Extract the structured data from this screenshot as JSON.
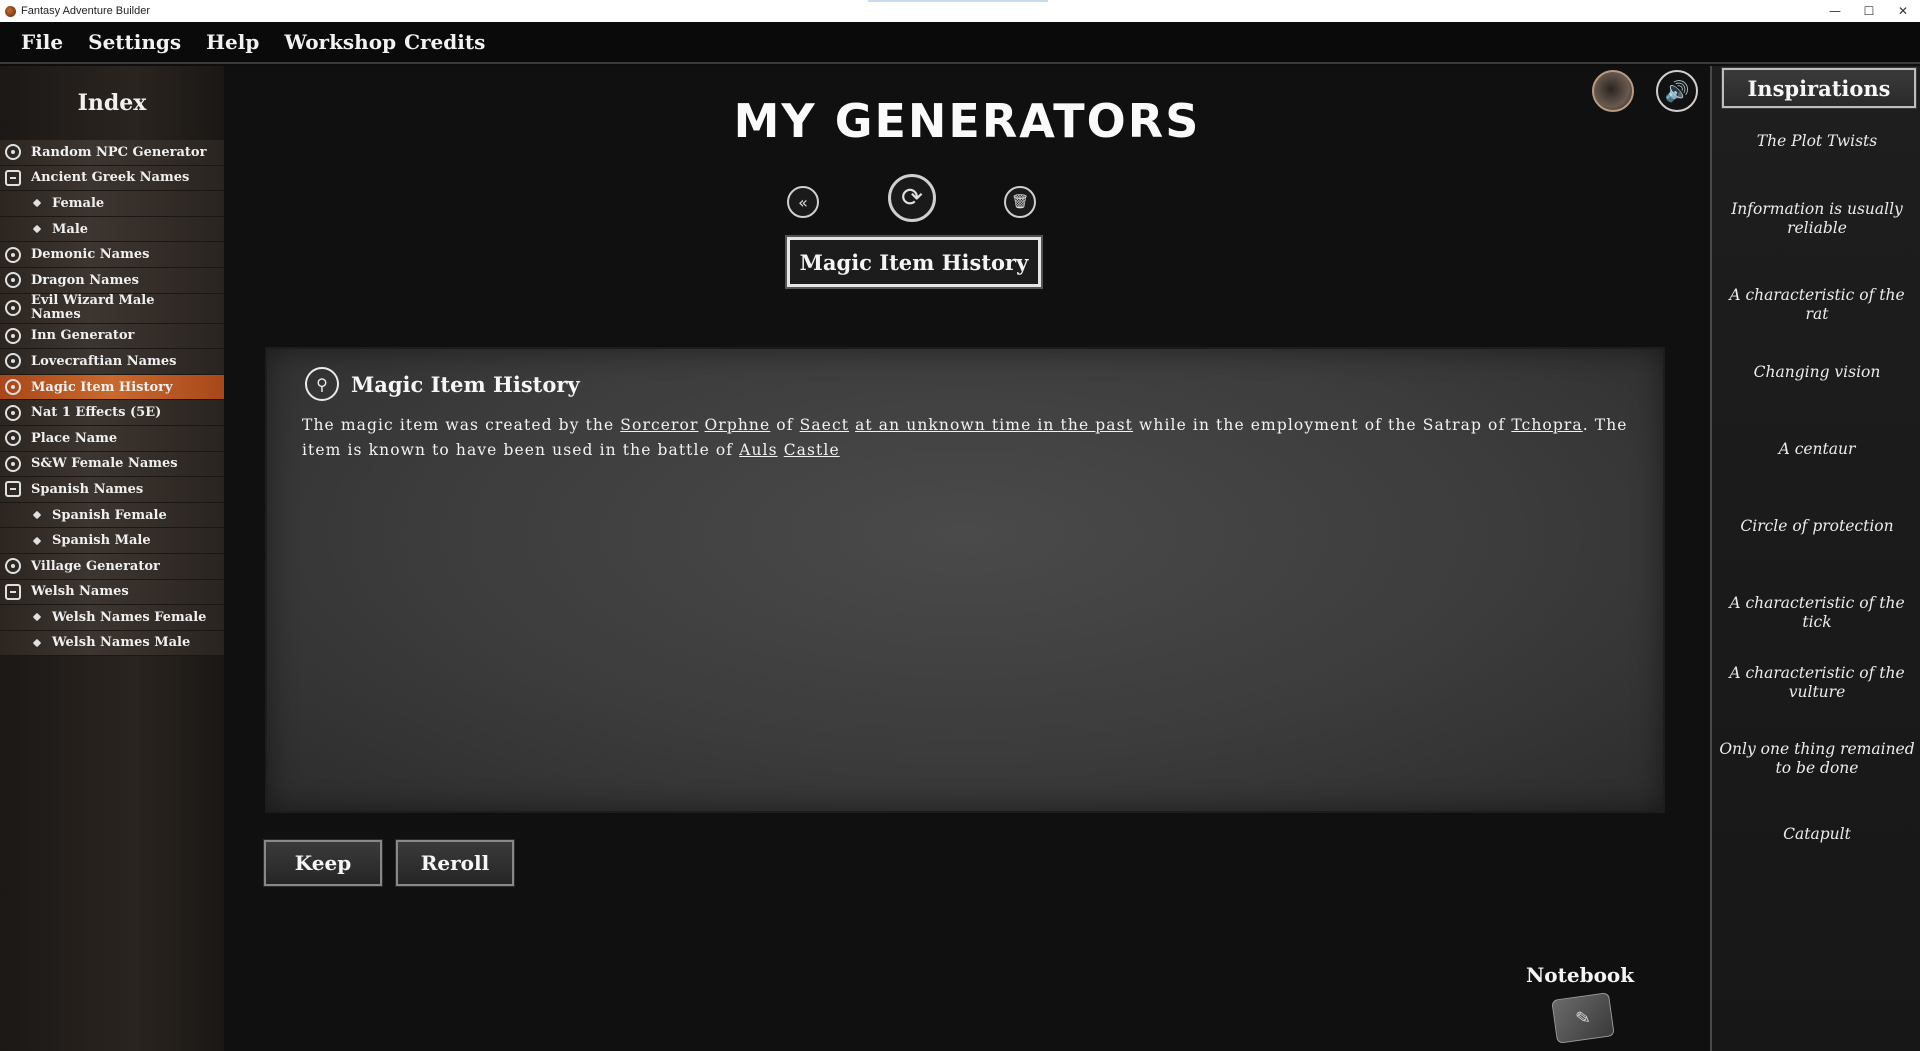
{
  "window": {
    "title": "Fantasy Adventure Builder",
    "controls": {
      "minimize": "—",
      "maximize": "☐",
      "close": "✕"
    }
  },
  "menu": {
    "file": "File",
    "settings": "Settings",
    "help": "Help",
    "workshop": "Workshop",
    "credits": "Credits"
  },
  "sidebar": {
    "title": "Index",
    "items": [
      {
        "label": "Random NPC Generator",
        "kind": "generator",
        "icon": "target-icon"
      },
      {
        "label": "Ancient Greek Names",
        "kind": "folder",
        "icon": "folder-icon"
      },
      {
        "label": "Female",
        "kind": "sub",
        "icon": "diamond-icon"
      },
      {
        "label": "Male",
        "kind": "sub",
        "icon": "diamond-icon"
      },
      {
        "label": "Demonic Names",
        "kind": "generator",
        "icon": "target-icon"
      },
      {
        "label": "Dragon Names",
        "kind": "generator",
        "icon": "target-icon"
      },
      {
        "label": "Evil Wizard Male Names",
        "kind": "generator",
        "icon": "target-icon"
      },
      {
        "label": "Inn Generator",
        "kind": "generator",
        "icon": "target-icon"
      },
      {
        "label": "Lovecraftian Names",
        "kind": "generator",
        "icon": "target-icon"
      },
      {
        "label": "Magic Item History",
        "kind": "generator",
        "icon": "target-icon",
        "active": true
      },
      {
        "label": "Nat 1 Effects (5E)",
        "kind": "generator",
        "icon": "target-icon"
      },
      {
        "label": "Place Name",
        "kind": "generator",
        "icon": "target-icon"
      },
      {
        "label": "S&W Female Names",
        "kind": "generator",
        "icon": "target-icon"
      },
      {
        "label": "Spanish Names",
        "kind": "folder",
        "icon": "folder-icon"
      },
      {
        "label": "Spanish Female",
        "kind": "sub",
        "icon": "diamond-icon"
      },
      {
        "label": "Spanish Male",
        "kind": "sub",
        "icon": "diamond-icon"
      },
      {
        "label": "Village Generator",
        "kind": "generator",
        "icon": "target-icon"
      },
      {
        "label": "Welsh Names",
        "kind": "folder",
        "icon": "folder-icon"
      },
      {
        "label": "Welsh Names Female",
        "kind": "sub",
        "icon": "diamond-icon"
      },
      {
        "label": "Welsh Names Male",
        "kind": "sub",
        "icon": "diamond-icon"
      }
    ]
  },
  "main": {
    "page_title": "MY GENERATORS",
    "toolbar": {
      "back_icon": "«",
      "reroll_icon": "⟳",
      "trash_icon": "🗑"
    },
    "selected_generator": "Magic Item History",
    "result": {
      "header": "Magic Item History",
      "header_icon": "pin-icon",
      "segments": [
        {
          "text": "The magic item was created by the ",
          "link": false
        },
        {
          "text": "Sorceror",
          "link": true
        },
        {
          "text": " ",
          "link": false
        },
        {
          "text": "Orphne",
          "link": true
        },
        {
          "text": " of ",
          "link": false
        },
        {
          "text": "Saect",
          "link": true
        },
        {
          "text": " ",
          "link": false
        },
        {
          "text": "at an unknown time in the past",
          "link": true
        },
        {
          "text": " while in the employment of the Satrap of ",
          "link": false
        },
        {
          "text": "Tchopra",
          "link": true
        },
        {
          "text": ". The item is known to have been used in the battle of ",
          "link": false
        },
        {
          "text": "Auls",
          "link": true
        },
        {
          "text": " ",
          "link": false
        },
        {
          "text": "Castle",
          "link": true
        }
      ]
    },
    "keep_label": "Keep",
    "reroll_label": "Reroll",
    "notebook_label": "Notebook"
  },
  "inspirations": {
    "title": "Inspirations",
    "items": [
      "The Plot Twists",
      "Information is usually reliable",
      "A characteristic of the rat",
      "Changing vision",
      "A centaur",
      "Circle of protection",
      "A characteristic of the tick",
      "A characteristic of the vulture",
      "Only one thing remained to be done",
      "Catapult"
    ]
  },
  "colors": {
    "active_item": "#c86a2e",
    "background": "#101010",
    "panel": "#3c3c3c"
  }
}
